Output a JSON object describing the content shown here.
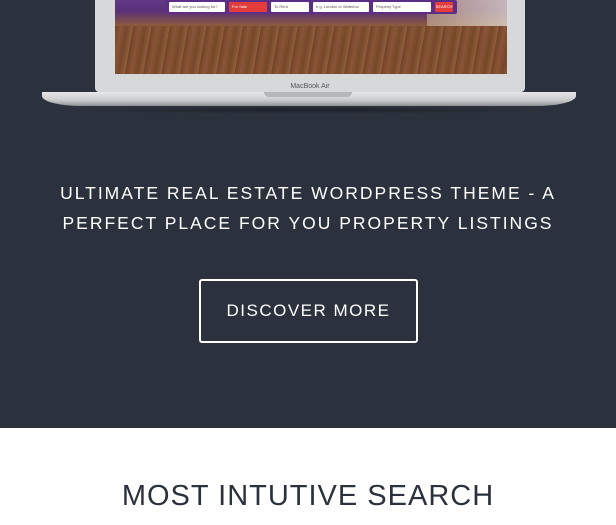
{
  "laptop": {
    "brand_label": "MacBook Air",
    "screen": {
      "search_fields": [
        "What are you looking for?",
        "For Sale",
        "To Rent",
        "e.g. London or Waterloo",
        "Property Type"
      ],
      "search_button": "SEARCH"
    }
  },
  "hero": {
    "tagline": "ULTIMATE REAL ESTATE WORDPRESS THEME - A PERFECT PLACE FOR YOU PROPERTY LISTINGS",
    "cta_label": "DISCOVER MORE"
  },
  "section": {
    "title": "MOST INTUTIVE SEARCH"
  },
  "colors": {
    "hero_bg": "#2c323d",
    "section_bg": "#ffffff",
    "accent_purple": "#5c2e86",
    "accent_red": "#e23c3c"
  }
}
